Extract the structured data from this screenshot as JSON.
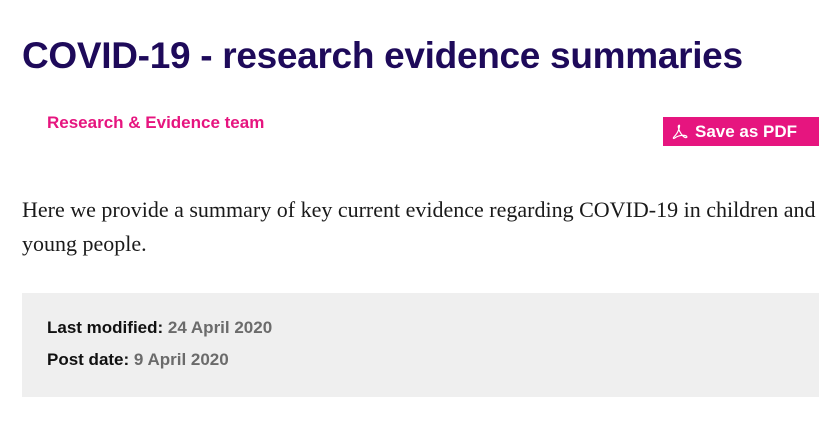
{
  "header": {
    "title": "COVID-19 - research evidence summaries",
    "team_link": "Research & Evidence team",
    "pdf_button": {
      "label": "Save as PDF",
      "icon": "pdf-icon"
    }
  },
  "main": {
    "intro": "Here we provide a summary of key current evidence regarding COVID-19 in children and young people."
  },
  "meta": {
    "last_modified_label": "Last modified:",
    "last_modified_value": "24 April 2020",
    "post_date_label": "Post date:",
    "post_date_value": "9 April 2020"
  },
  "colors": {
    "title": "#1e0a5a",
    "accent": "#e6157f",
    "meta_background": "#efefef",
    "meta_value": "#6b6b6b"
  }
}
